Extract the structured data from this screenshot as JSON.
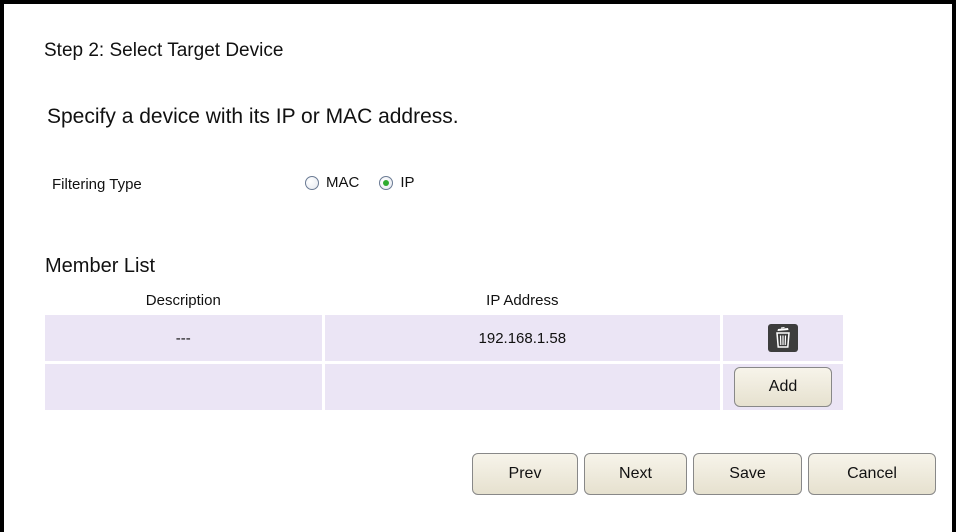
{
  "page": {
    "step_title": "Step 2: Select Target Device",
    "instruction": "Specify a device with its IP or MAC address."
  },
  "filtering": {
    "label": "Filtering Type",
    "options": [
      {
        "label": "MAC",
        "checked": false
      },
      {
        "label": "IP",
        "checked": true
      }
    ]
  },
  "member_list": {
    "title": "Member List",
    "columns": [
      "Description",
      "IP Address",
      ""
    ],
    "rows": [
      {
        "description": "---",
        "ip_address": "192.168.1.58",
        "action_icon": "trash-icon"
      }
    ],
    "add_label": "Add"
  },
  "buttons": {
    "prev": "Prev",
    "next": "Next",
    "save": "Save",
    "cancel": "Cancel"
  },
  "colors": {
    "row_background": "#ebe5f5",
    "radio_checked": "#2eab2e",
    "trash_button": "#3d3d3d"
  }
}
